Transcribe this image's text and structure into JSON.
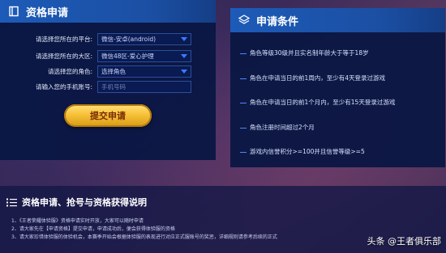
{
  "apply_panel": {
    "title": "资格申请",
    "fields": [
      {
        "label": "请选择您所在的平台:",
        "value": "微信-安卓(android)"
      },
      {
        "label": "请选择您所在的大区:",
        "value": "微信48区-爱心护理"
      },
      {
        "label": "请选择您的角色:",
        "value": "选择角色"
      },
      {
        "label": "请输入您的手机账号:",
        "placeholder": "手机号码"
      }
    ],
    "submit_label": "提交申请"
  },
  "conditions_panel": {
    "title": "申请条件",
    "items": [
      "角色等级30级并且实名制年龄大于等于18岁",
      "角色在申请当日的前1周内，至少有4天登录过游戏",
      "角色在申请当日的前1个月内，至少有15天登录过游戏",
      "角色注册时间超过2个月",
      "游戏内信誉积分>=100并且信誉等级>=5"
    ]
  },
  "notes_panel": {
    "title": "资格申请、抢号与资格获得说明",
    "notes": [
      "1、《王者荣耀体验服》资格申请实时开放，大家可以随时申请",
      "2、请大家先在【申请资格】提交申请，申请成功后，便会获得体验服的资格",
      "3、请大家珍惜体验服的体验机会，本赛季开始会根据体验服的表现进行对应正式服账号的奖惩，详细规则请参考后续的正式"
    ]
  },
  "watermark": "头条 @王者俱乐部",
  "colors": {
    "header": "#1d5bb8",
    "panel": "#08164a",
    "button": "#f7c23a",
    "accent": "#4a86ff"
  }
}
